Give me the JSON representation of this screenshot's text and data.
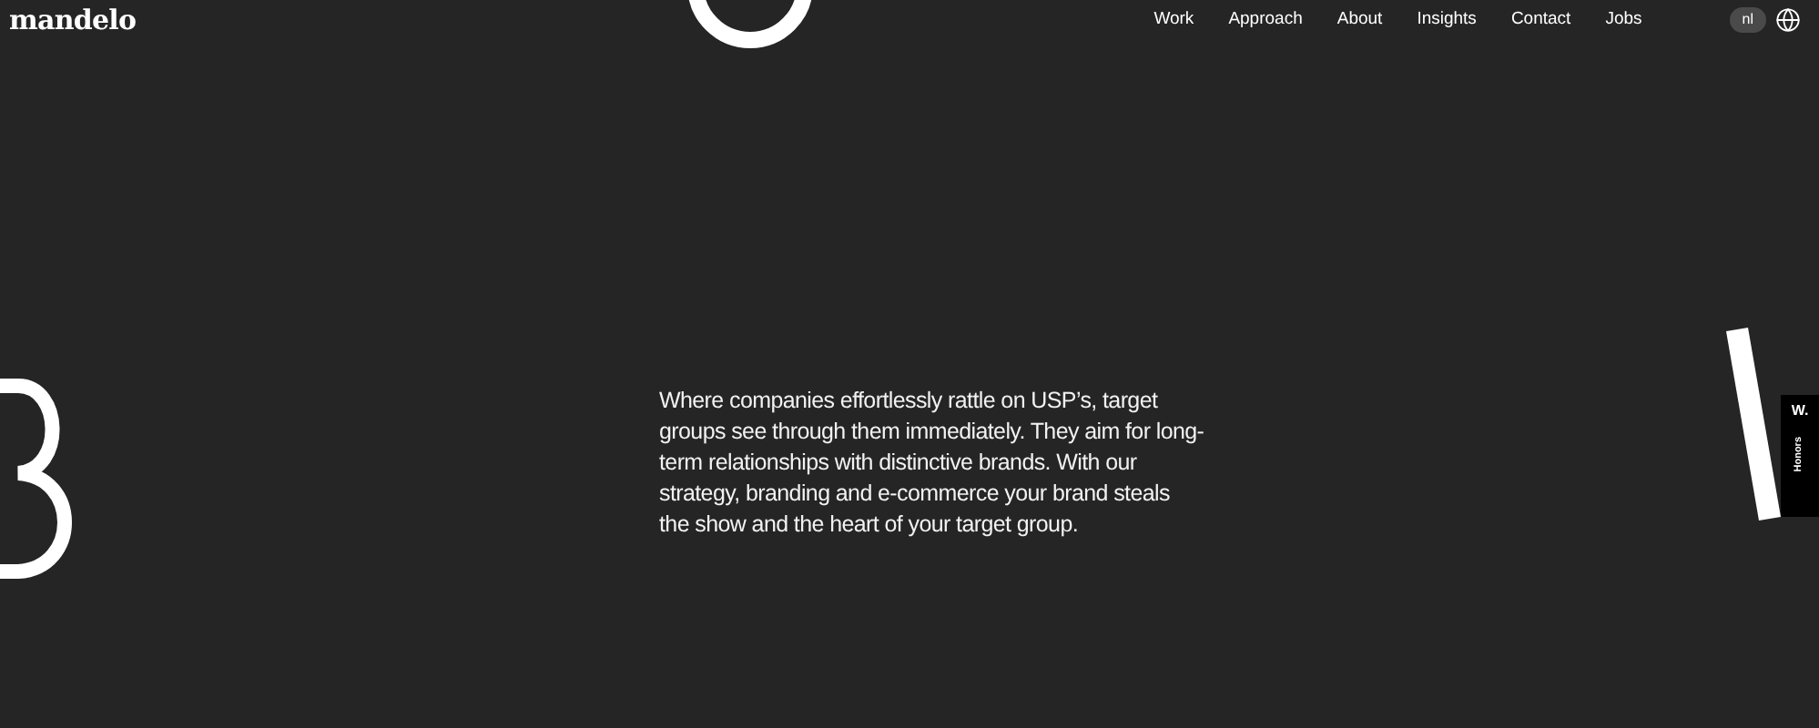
{
  "logo": "mandelo",
  "nav": [
    {
      "label": "Work"
    },
    {
      "label": "Approach"
    },
    {
      "label": "About"
    },
    {
      "label": "Insights"
    },
    {
      "label": "Contact"
    },
    {
      "label": "Jobs"
    }
  ],
  "language": "nl",
  "intro": "Where companies effortlessly rattle on USP’s, target groups see through them immediately. They aim for long-term relationships with distinctive brands. With our strategy, branding and e-commerce your brand steals the show and the heart of your target group.",
  "award_badge": {
    "mark": "W.",
    "label": "Honors"
  }
}
